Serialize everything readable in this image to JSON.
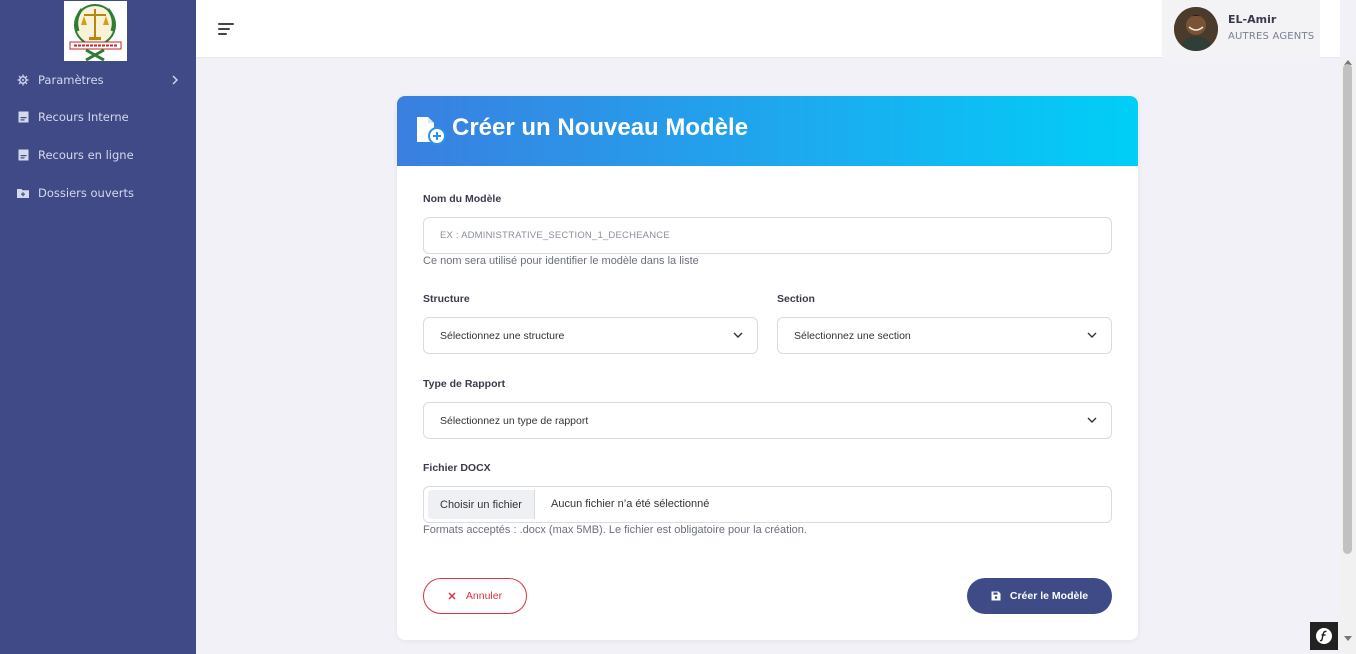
{
  "sidebar": {
    "items": [
      {
        "label": "Paramètres",
        "icon": "gear-icon"
      },
      {
        "label": "Recours Interne",
        "icon": "document-icon"
      },
      {
        "label": "Recours en ligne",
        "icon": "document-icon"
      },
      {
        "label": "Dossiers ouverts",
        "icon": "folder-plus-icon"
      }
    ]
  },
  "header": {
    "user": {
      "name": "EL-Amir",
      "role": "AUTRES AGENTS"
    }
  },
  "form": {
    "title": "Créer un Nouveau Modèle",
    "name": {
      "label": "Nom du Modèle",
      "placeholder": "EX : ADMINISTRATIVE_SECTION_1_DECHEANCE",
      "help": "Ce nom sera utilisé pour identifier le modèle dans la liste"
    },
    "structure": {
      "label": "Structure",
      "selected": "Sélectionnez une structure"
    },
    "section": {
      "label": "Section",
      "selected": "Sélectionnez une section"
    },
    "report_type": {
      "label": "Type de Rapport",
      "selected": "Sélectionnez un type de rapport"
    },
    "file": {
      "label": "Fichier DOCX",
      "button": "Choisir un fichier",
      "status": "Aucun fichier n’a été sélectionné",
      "help": "Formats acceptés : .docx (max 5MB). Le fichier est obligatoire pour la création."
    },
    "cancel_label": "Annuler",
    "create_label": "Créer le Modèle"
  },
  "colors": {
    "sidebar": "#3f4a86",
    "header_gradient_start": "#3a7fe0",
    "header_gradient_end": "#00cff7",
    "cancel": "#d9343f",
    "primary": "#3e4b87"
  }
}
